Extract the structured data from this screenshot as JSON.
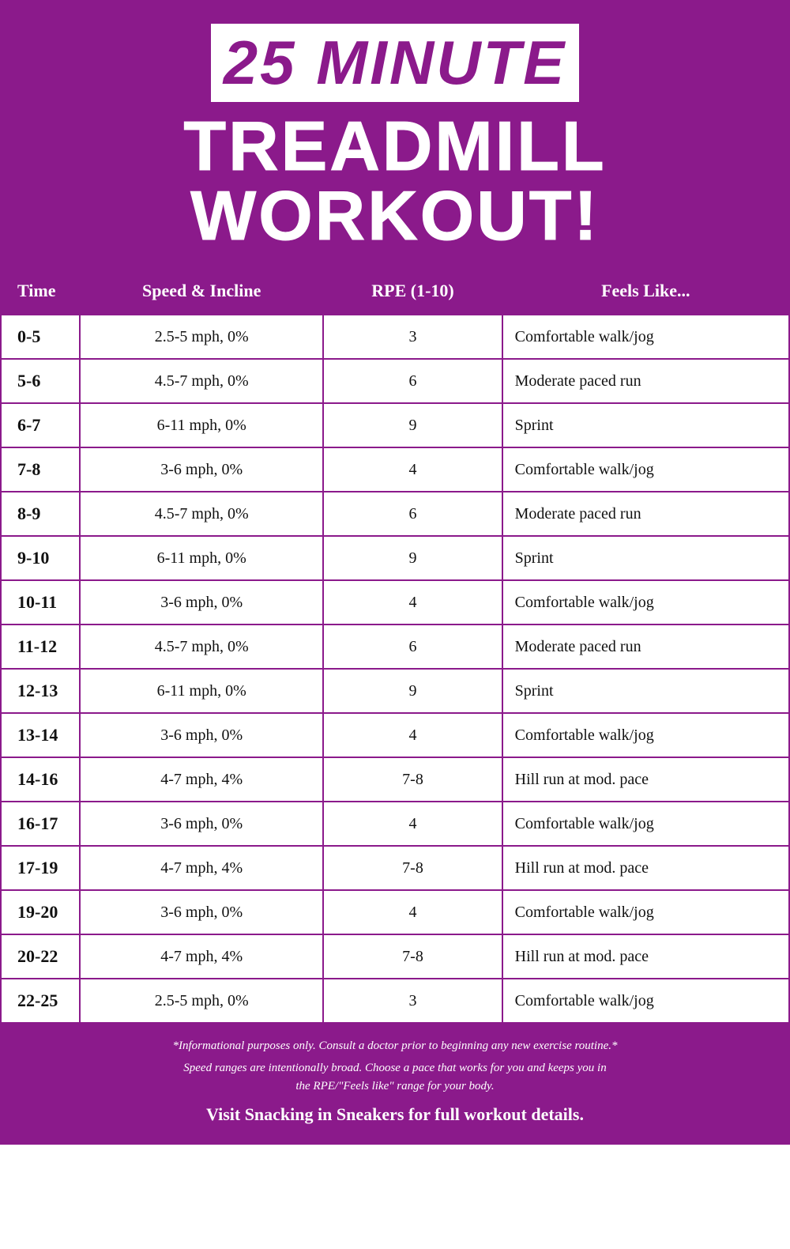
{
  "header": {
    "title_top": "25 MINUTE",
    "title_bottom": "TREADMILL WORKOUT!"
  },
  "table": {
    "columns": [
      "Time",
      "Speed & Incline",
      "RPE (1-10)",
      "Feels Like..."
    ],
    "rows": [
      {
        "time": "0-5",
        "speed": "2.5-5 mph, 0%",
        "rpe": "3",
        "feels": "Comfortable walk/jog"
      },
      {
        "time": "5-6",
        "speed": "4.5-7 mph, 0%",
        "rpe": "6",
        "feels": "Moderate paced run"
      },
      {
        "time": "6-7",
        "speed": "6-11 mph, 0%",
        "rpe": "9",
        "feels": "Sprint"
      },
      {
        "time": "7-8",
        "speed": "3-6 mph, 0%",
        "rpe": "4",
        "feels": "Comfortable walk/jog"
      },
      {
        "time": "8-9",
        "speed": "4.5-7 mph, 0%",
        "rpe": "6",
        "feels": "Moderate paced run"
      },
      {
        "time": "9-10",
        "speed": "6-11 mph, 0%",
        "rpe": "9",
        "feels": "Sprint"
      },
      {
        "time": "10-11",
        "speed": "3-6 mph, 0%",
        "rpe": "4",
        "feels": "Comfortable walk/jog"
      },
      {
        "time": "11-12",
        "speed": "4.5-7 mph, 0%",
        "rpe": "6",
        "feels": "Moderate paced run"
      },
      {
        "time": "12-13",
        "speed": "6-11 mph, 0%",
        "rpe": "9",
        "feels": "Sprint"
      },
      {
        "time": "13-14",
        "speed": "3-6 mph, 0%",
        "rpe": "4",
        "feels": "Comfortable walk/jog"
      },
      {
        "time": "14-16",
        "speed": "4-7 mph, 4%",
        "rpe": "7-8",
        "feels": "Hill run at mod. pace"
      },
      {
        "time": "16-17",
        "speed": "3-6 mph, 0%",
        "rpe": "4",
        "feels": "Comfortable walk/jog"
      },
      {
        "time": "17-19",
        "speed": "4-7 mph, 4%",
        "rpe": "7-8",
        "feels": "Hill run at mod. pace"
      },
      {
        "time": "19-20",
        "speed": "3-6 mph, 0%",
        "rpe": "4",
        "feels": "Comfortable walk/jog"
      },
      {
        "time": "20-22",
        "speed": "4-7 mph, 4%",
        "rpe": "7-8",
        "feels": "Hill run at mod. pace"
      },
      {
        "time": "22-25",
        "speed": "2.5-5 mph, 0%",
        "rpe": "3",
        "feels": "Comfortable walk/jog"
      }
    ]
  },
  "footer": {
    "disclaimer": "*Informational purposes only. Consult a doctor prior to beginning any new exercise routine.*",
    "note": "Speed ranges are intentionally broad. Choose a pace that works for you and keeps you in\nthe RPE/\"Feels like\" range for your body.",
    "visit": "Visit Snacking in Sneakers for full workout details."
  }
}
